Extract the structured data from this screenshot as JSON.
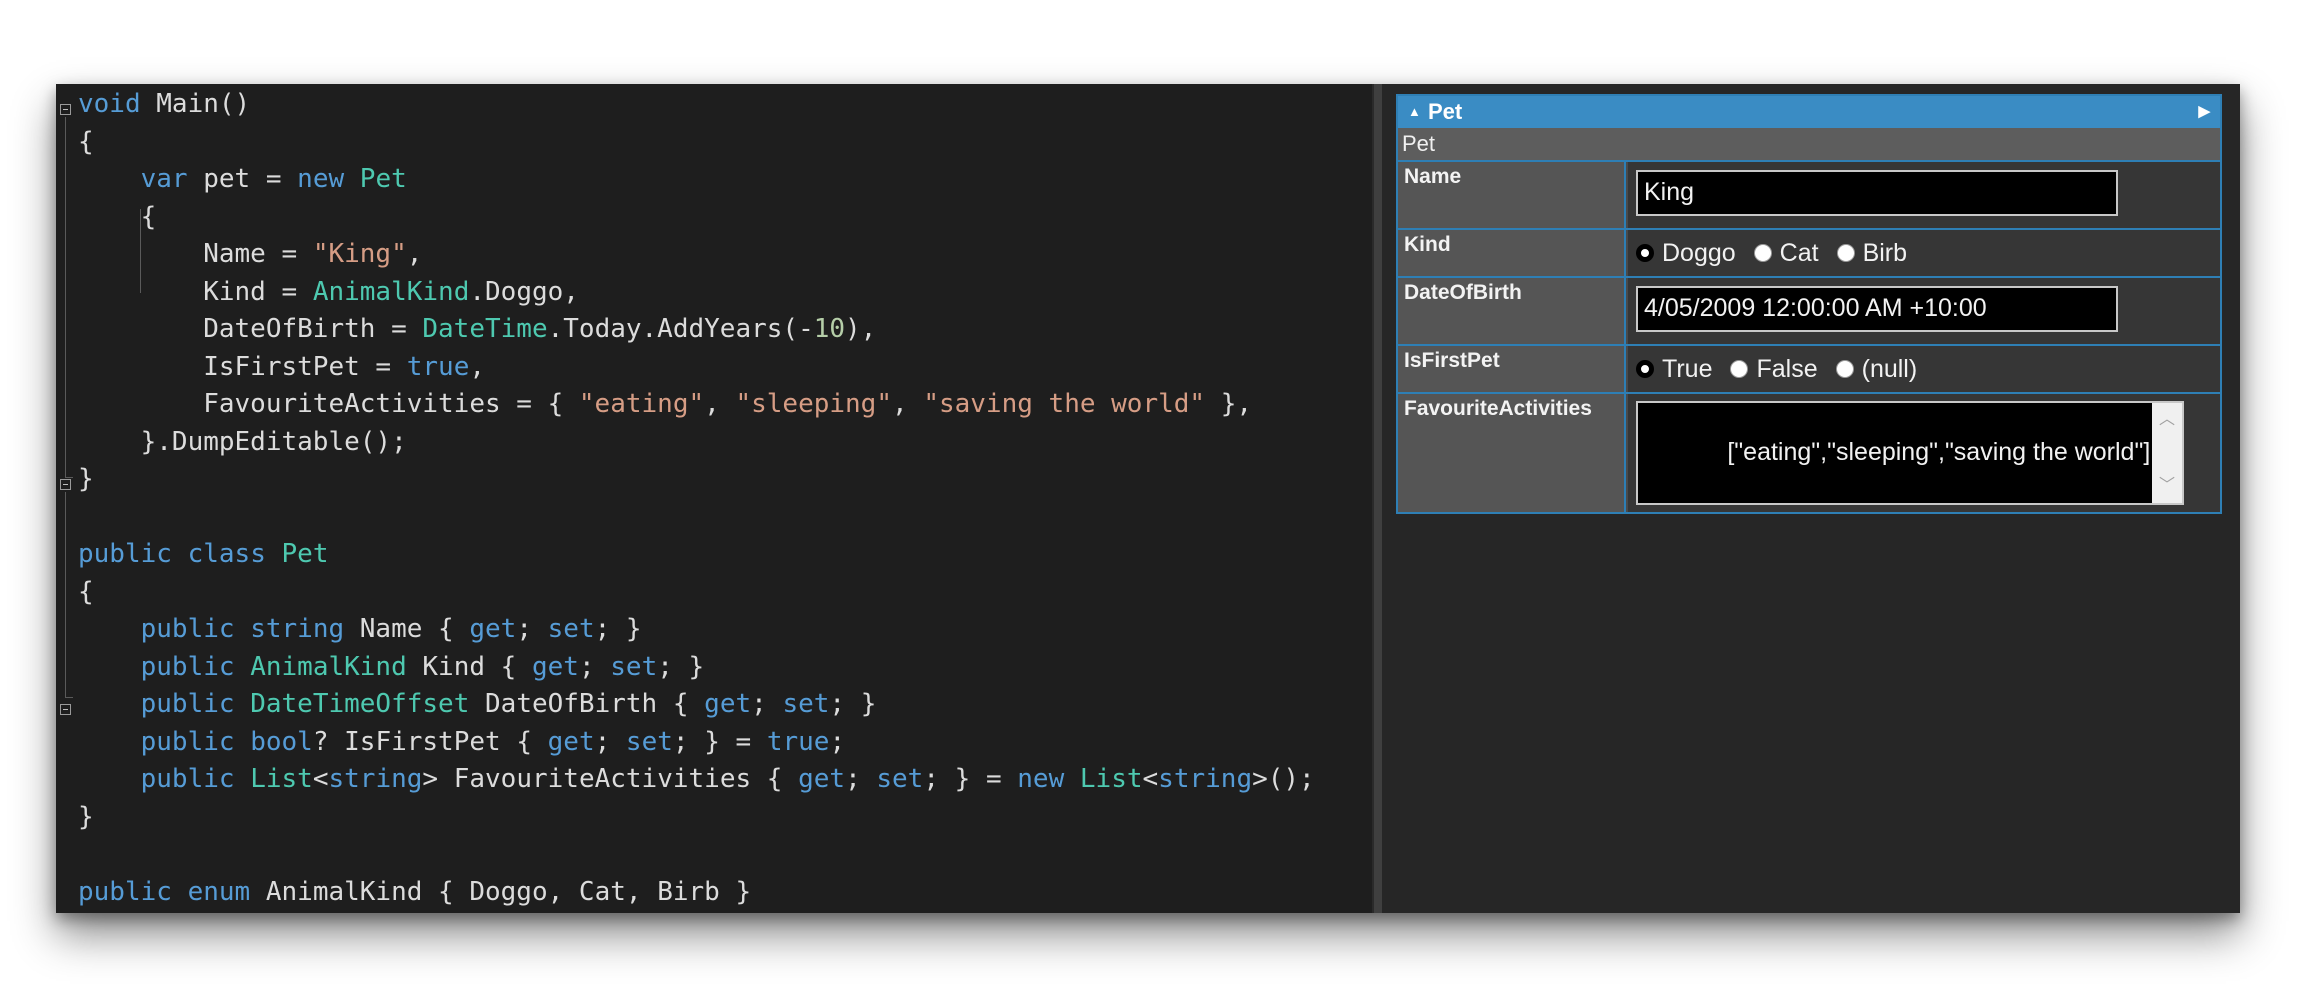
{
  "code": {
    "lines": [
      [
        {
          "t": "void",
          "c": "kw"
        },
        {
          "t": " Main()"
        }
      ],
      [
        {
          "t": "{"
        }
      ],
      [
        {
          "t": "    "
        },
        {
          "t": "var",
          "c": "kw"
        },
        {
          "t": " pet = "
        },
        {
          "t": "new",
          "c": "kw"
        },
        {
          "t": " "
        },
        {
          "t": "Pet",
          "c": "ty"
        }
      ],
      [
        {
          "t": "    {"
        }
      ],
      [
        {
          "t": "        Name = "
        },
        {
          "t": "\"King\"",
          "c": "st"
        },
        {
          "t": ","
        }
      ],
      [
        {
          "t": "        Kind = "
        },
        {
          "t": "AnimalKind",
          "c": "ty"
        },
        {
          "t": ".Doggo,"
        }
      ],
      [
        {
          "t": "        DateOfBirth = "
        },
        {
          "t": "DateTime",
          "c": "ty"
        },
        {
          "t": ".Today.AddYears(-"
        },
        {
          "t": "10",
          "c": "nu"
        },
        {
          "t": "),"
        }
      ],
      [
        {
          "t": "        IsFirstPet = "
        },
        {
          "t": "true",
          "c": "kw"
        },
        {
          "t": ","
        }
      ],
      [
        {
          "t": "        FavouriteActivities = { "
        },
        {
          "t": "\"eating\"",
          "c": "st"
        },
        {
          "t": ", "
        },
        {
          "t": "\"sleeping\"",
          "c": "st"
        },
        {
          "t": ", "
        },
        {
          "t": "\"saving the world\"",
          "c": "st"
        },
        {
          "t": " },"
        }
      ],
      [
        {
          "t": "    }.DumpEditable();"
        }
      ],
      [
        {
          "t": "}"
        }
      ],
      [],
      [
        {
          "t": "public",
          "c": "kw"
        },
        {
          "t": " "
        },
        {
          "t": "class",
          "c": "kw"
        },
        {
          "t": " "
        },
        {
          "t": "Pet",
          "c": "ty"
        }
      ],
      [
        {
          "t": "{"
        }
      ],
      [
        {
          "t": "    "
        },
        {
          "t": "public",
          "c": "kw"
        },
        {
          "t": " "
        },
        {
          "t": "string",
          "c": "kw"
        },
        {
          "t": " Name { "
        },
        {
          "t": "get",
          "c": "kw"
        },
        {
          "t": "; "
        },
        {
          "t": "set",
          "c": "kw"
        },
        {
          "t": "; }"
        }
      ],
      [
        {
          "t": "    "
        },
        {
          "t": "public",
          "c": "kw"
        },
        {
          "t": " "
        },
        {
          "t": "AnimalKind",
          "c": "ty"
        },
        {
          "t": " Kind { "
        },
        {
          "t": "get",
          "c": "kw"
        },
        {
          "t": "; "
        },
        {
          "t": "set",
          "c": "kw"
        },
        {
          "t": "; }"
        }
      ],
      [
        {
          "t": "    "
        },
        {
          "t": "public",
          "c": "kw"
        },
        {
          "t": " "
        },
        {
          "t": "DateTimeOffset",
          "c": "ty"
        },
        {
          "t": " DateOfBirth { "
        },
        {
          "t": "get",
          "c": "kw"
        },
        {
          "t": "; "
        },
        {
          "t": "set",
          "c": "kw"
        },
        {
          "t": "; }"
        }
      ],
      [
        {
          "t": "    "
        },
        {
          "t": "public",
          "c": "kw"
        },
        {
          "t": " "
        },
        {
          "t": "bool",
          "c": "kw"
        },
        {
          "t": "? IsFirstPet { "
        },
        {
          "t": "get",
          "c": "kw"
        },
        {
          "t": "; "
        },
        {
          "t": "set",
          "c": "kw"
        },
        {
          "t": "; } = "
        },
        {
          "t": "true",
          "c": "kw"
        },
        {
          "t": ";"
        }
      ],
      [
        {
          "t": "    "
        },
        {
          "t": "public",
          "c": "kw"
        },
        {
          "t": " "
        },
        {
          "t": "List",
          "c": "ty"
        },
        {
          "t": "<"
        },
        {
          "t": "string",
          "c": "kw"
        },
        {
          "t": "> FavouriteActivities { "
        },
        {
          "t": "get",
          "c": "kw"
        },
        {
          "t": "; "
        },
        {
          "t": "set",
          "c": "kw"
        },
        {
          "t": "; } = "
        },
        {
          "t": "new",
          "c": "kw"
        },
        {
          "t": " "
        },
        {
          "t": "List",
          "c": "ty"
        },
        {
          "t": "<"
        },
        {
          "t": "string",
          "c": "kw"
        },
        {
          "t": ">();"
        }
      ],
      [
        {
          "t": "}"
        }
      ],
      [],
      [
        {
          "t": "public",
          "c": "kw"
        },
        {
          "t": " "
        },
        {
          "t": "enum",
          "c": "kw"
        },
        {
          "t": " AnimalKind { Doggo, Cat, Birb }"
        }
      ]
    ]
  },
  "result": {
    "header_title": "Pet",
    "header_collapse_icon": "triangle-up-icon",
    "header_expand_icon": "triangle-right-icon",
    "type_label": "Pet",
    "name": {
      "label": "Name",
      "value": "King"
    },
    "kind": {
      "label": "Kind",
      "options": [
        "Doggo",
        "Cat",
        "Birb"
      ],
      "selected": 0
    },
    "date_of_birth": {
      "label": "DateOfBirth",
      "value": "4/05/2009 12:00:00 AM +10:00"
    },
    "is_first_pet": {
      "label": "IsFirstPet",
      "options": [
        "True",
        "False",
        "(null)"
      ],
      "selected": 0
    },
    "favourite_activities": {
      "label": "FavouriteActivities",
      "value": "[\"eating\",\"sleeping\",\"saving the world\"]"
    }
  },
  "colors": {
    "editor_bg": "#1e1e1e",
    "keyword": "#569cd6",
    "type": "#4ec9b0",
    "string": "#d69d85",
    "number": "#b5cea8",
    "accent": "#3a8cc4"
  }
}
